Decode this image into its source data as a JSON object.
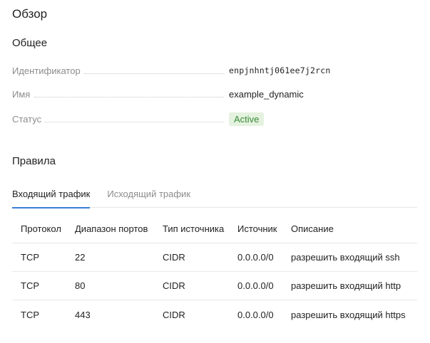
{
  "page_title": "Обзор",
  "general": {
    "title": "Общее",
    "fields": [
      {
        "label": "Идентификатор",
        "value": "enpjnhntj061ee7j2rcn"
      },
      {
        "label": "Имя",
        "value": "example_dynamic"
      },
      {
        "label": "Статус",
        "value": "Active"
      }
    ]
  },
  "rules": {
    "title": "Правила",
    "tabs": [
      {
        "label": "Входящий трафик",
        "active": true
      },
      {
        "label": "Исходящий трафик",
        "active": false
      }
    ],
    "columns": [
      "Протокол",
      "Диапазон портов",
      "Тип источника",
      "Источник",
      "Описание"
    ],
    "rows": [
      [
        "TCP",
        "22",
        "CIDR",
        "0.0.0.0/0",
        "разрешить входящий ssh"
      ],
      [
        "TCP",
        "80",
        "CIDR",
        "0.0.0.0/0",
        "разрешить входящий http"
      ],
      [
        "TCP",
        "443",
        "CIDR",
        "0.0.0.0/0",
        "разрешить входящий https"
      ]
    ]
  },
  "colors": {
    "status_bg": "#e4f2df",
    "status_text": "#3a8a3a",
    "tab_underline": "#3a7ed6"
  }
}
